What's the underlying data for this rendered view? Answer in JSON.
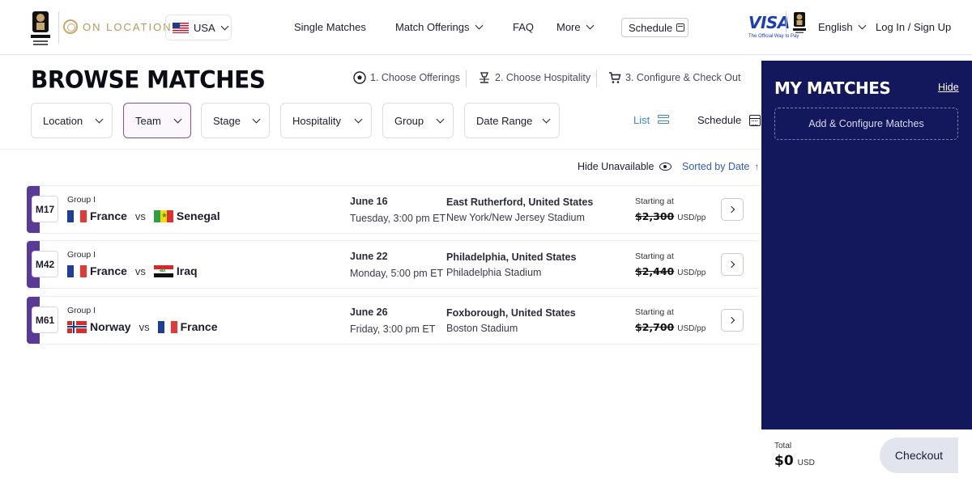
{
  "header": {
    "brand_label": "ON LOCATION",
    "country": "USA",
    "nav": [
      {
        "label": "Single Matches"
      },
      {
        "label": "Match Offerings"
      },
      {
        "label": "FAQ"
      },
      {
        "label": "More"
      }
    ],
    "schedule_button": "Schedule",
    "sponsor_word": "VISA",
    "sponsor_tagline": "The Official Way to Pay",
    "language": "English",
    "login": "Log In / Sign Up"
  },
  "page": {
    "title": "BROWSE MATCHES",
    "steps": [
      {
        "label": "1. Choose Offerings",
        "icon": "ball-icon"
      },
      {
        "label": "2. Choose Hospitality",
        "icon": "champagne-icon"
      },
      {
        "label": "3. Configure & Check Out",
        "icon": "cart-icon"
      }
    ],
    "filters": [
      {
        "label": "Location"
      },
      {
        "label": "Team"
      },
      {
        "label": "Stage"
      },
      {
        "label": "Hospitality"
      },
      {
        "label": "Group"
      },
      {
        "label": "Date Range"
      }
    ],
    "view_list": "List",
    "view_schedule": "Schedule",
    "hide_unavailable": "Hide Unavailable",
    "sorted_by": "Sorted by Date"
  },
  "matches": [
    {
      "code": "M17",
      "group": "Group I",
      "home": "France",
      "away": "Senegal",
      "vs": "vs",
      "date": "June 16",
      "time": "Tuesday, 3:00 pm ET",
      "city": "East Rutherford, United States",
      "stadium": "New York/New Jersey Stadium",
      "starting_label": "Starting at",
      "price": "$2,300",
      "price_unit": "USD/pp"
    },
    {
      "code": "M42",
      "group": "Group I",
      "home": "France",
      "away": "Iraq",
      "vs": "vs",
      "date": "June 22",
      "time": "Monday, 5:00 pm ET",
      "city": "Philadelphia, United States",
      "stadium": "Philadelphia Stadium",
      "starting_label": "Starting at",
      "price": "$2,440",
      "price_unit": "USD/pp"
    },
    {
      "code": "M61",
      "group": "Group I",
      "home": "Norway",
      "away": "France",
      "vs": "vs",
      "date": "June 26",
      "time": "Friday, 3:00 pm ET",
      "city": "Foxborough, United States",
      "stadium": "Boston Stadium",
      "starting_label": "Starting at",
      "price": "$2,700",
      "price_unit": "USD/pp"
    }
  ],
  "sidebar": {
    "title": "MY MATCHES",
    "hide": "Hide",
    "add_button": "Add & Configure Matches",
    "total_label": "Total",
    "total_amount": "$0",
    "total_currency": "USD",
    "checkout": "Checkout"
  },
  "colors": {
    "sidebar_bg": "#13175c",
    "row_accent": "#5a3a96",
    "link_blue": "#2f5db8",
    "gold": "#b8975a"
  }
}
